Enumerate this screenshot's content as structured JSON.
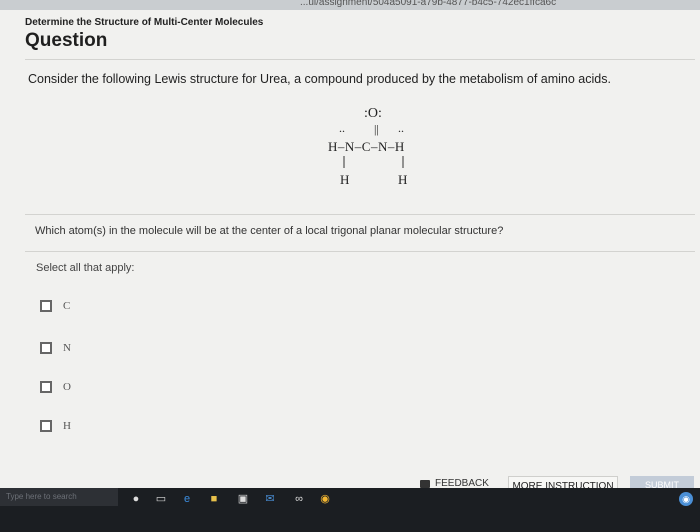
{
  "browser": {
    "url_fragment": "...ui/assignment/504a5091-a79b-4877-b4c5-742ec1ffca6c"
  },
  "module": {
    "title": "Determine the Structure of Multi-Center Molecules"
  },
  "section": {
    "title": "Question"
  },
  "prompt": {
    "intro": "Consider the following Lewis structure for Urea, a compound produced by the metabolism of amino acids.",
    "question": "Which atom(s) in the molecule will be at the center of a local trigonal planar molecular structure?",
    "select_note": "Select all that apply:"
  },
  "lewis_structure": {
    "top_atom": ":O:",
    "double_bond": "||",
    "lone_pair_left": "..",
    "lone_pair_right": "..",
    "chain": "H–N–C–N–H",
    "bottom_left_h": "H",
    "bottom_right_h": "H"
  },
  "options": [
    {
      "label": "C",
      "checked": false
    },
    {
      "label": "N",
      "checked": false
    },
    {
      "label": "O",
      "checked": false
    },
    {
      "label": "H",
      "checked": false
    }
  ],
  "actions": {
    "feedback_label": "FEEDBACK",
    "more_instruction_label": "MORE INSTRUCTION",
    "submit_label": "SUBMIT"
  },
  "taskbar": {
    "search_placeholder": "Type here to search",
    "icons": [
      "microphone-icon",
      "task-view-icon",
      "edge-icon",
      "file-explorer-icon",
      "store-icon",
      "mail-icon",
      "people-icon",
      "chrome-icon"
    ]
  },
  "colors": {
    "page_bg": "#f1f1ef",
    "submit_disabled": "#c3ccd8",
    "taskbar": "#1b1e22"
  }
}
